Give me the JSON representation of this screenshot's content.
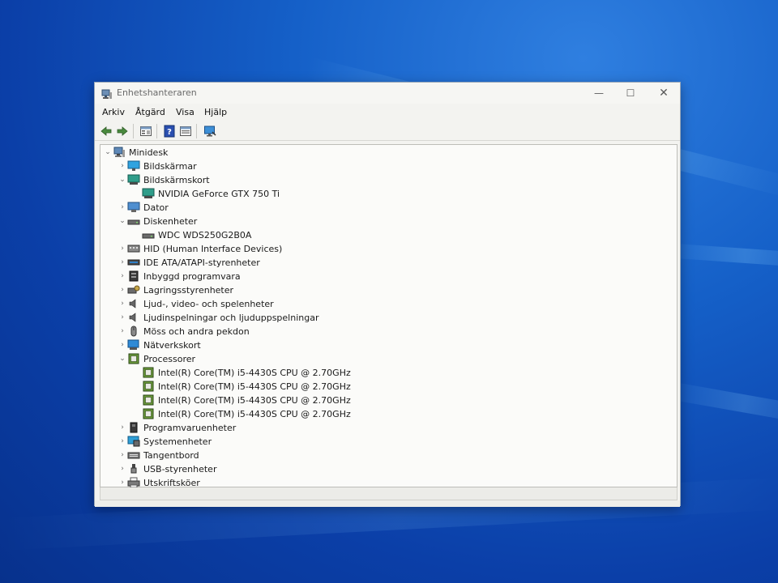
{
  "window": {
    "title": "Enhetshanteraren"
  },
  "menu": {
    "items": [
      "Arkiv",
      "Åtgärd",
      "Visa",
      "Hjälp"
    ]
  },
  "toolbar": {
    "buttons": [
      "back-arrow-icon",
      "forward-arrow-icon",
      "properties-icon",
      "help-icon",
      "view-icon",
      "monitor-scan-icon"
    ]
  },
  "tree": {
    "root": "Minidesk",
    "nodes": [
      {
        "label": "Bildskärmar",
        "icon": "monitor-icon",
        "expanded": false
      },
      {
        "label": "Bildskärmskort",
        "icon": "display-adapter-icon",
        "expanded": true
      },
      {
        "label": "NVIDIA GeForce GTX 750 Ti",
        "icon": "display-adapter-icon"
      },
      {
        "label": "Dator",
        "icon": "computer-icon",
        "expanded": false
      },
      {
        "label": "Diskenheter",
        "icon": "disk-drive-icon",
        "expanded": true
      },
      {
        "label": "WDC WDS250G2B0A",
        "icon": "disk-drive-icon"
      },
      {
        "label": "HID (Human Interface Devices)",
        "icon": "hid-icon",
        "expanded": false
      },
      {
        "label": "IDE ATA/ATAPI-styrenheter",
        "icon": "ide-controller-icon",
        "expanded": false
      },
      {
        "label": "Inbyggd programvara",
        "icon": "firmware-icon",
        "expanded": false
      },
      {
        "label": "Lagringsstyrenheter",
        "icon": "storage-controller-icon",
        "expanded": false
      },
      {
        "label": "Ljud-, video- och spelenheter",
        "icon": "speaker-icon",
        "expanded": false
      },
      {
        "label": "Ljudinspelningar och ljuduppspelningar",
        "icon": "speaker-icon",
        "expanded": false
      },
      {
        "label": "Möss och andra pekdon",
        "icon": "mouse-icon",
        "expanded": false
      },
      {
        "label": "Nätverkskort",
        "icon": "network-adapter-icon",
        "expanded": false
      },
      {
        "label": "Processorer",
        "icon": "processor-icon",
        "expanded": true
      },
      {
        "label": "Intel(R) Core(TM) i5-4430S CPU @ 2.70GHz",
        "icon": "processor-icon"
      },
      {
        "label": "Intel(R) Core(TM) i5-4430S CPU @ 2.70GHz",
        "icon": "processor-icon"
      },
      {
        "label": "Intel(R) Core(TM) i5-4430S CPU @ 2.70GHz",
        "icon": "processor-icon"
      },
      {
        "label": "Intel(R) Core(TM) i5-4430S CPU @ 2.70GHz",
        "icon": "processor-icon"
      },
      {
        "label": "Programvaruenheter",
        "icon": "software-device-icon",
        "expanded": false
      },
      {
        "label": "Systemenheter",
        "icon": "system-device-icon",
        "expanded": false
      },
      {
        "label": "Tangentbord",
        "icon": "keyboard-icon",
        "expanded": false
      },
      {
        "label": "USB-styrenheter",
        "icon": "usb-icon",
        "expanded": false
      },
      {
        "label": "Utskriftsköer",
        "icon": "printer-icon",
        "expanded": false
      }
    ]
  }
}
